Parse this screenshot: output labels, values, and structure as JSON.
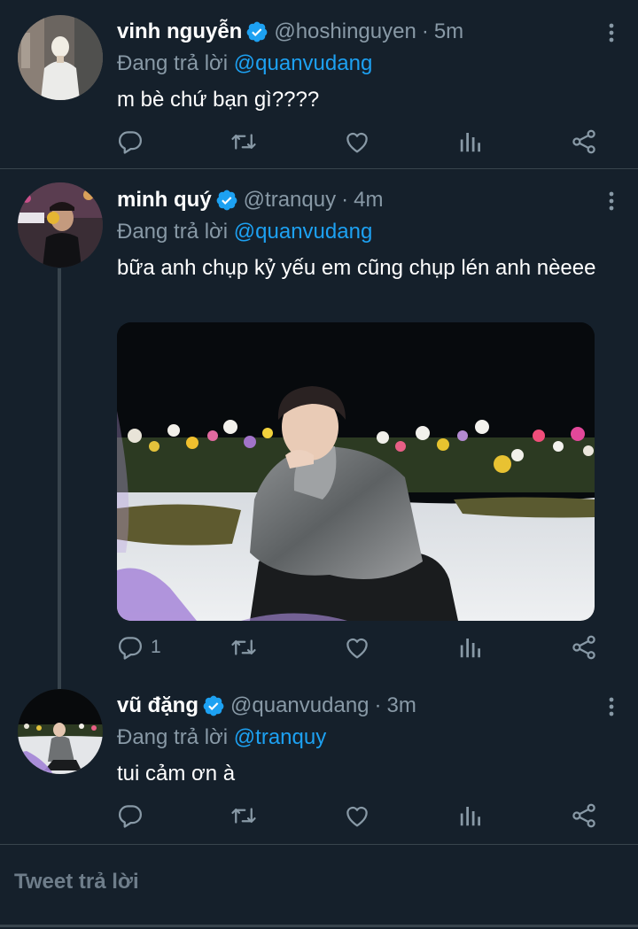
{
  "tweets": [
    {
      "name": "vinh nguyễn",
      "handle": "@hoshinguyen",
      "dot": "·",
      "time": "5m",
      "replying_label": "Đang trả lời",
      "replying_to": "@quanvudang",
      "text": "m bè chứ bạn gì????",
      "reply_count": ""
    },
    {
      "name": "minh quý",
      "handle": "@tranquy",
      "dot": "·",
      "time": "4m",
      "replying_label": "Đang trả lời",
      "replying_to": "@quanvudang",
      "text": "bữa anh chụp kỷ yếu em cũng chụp lén anh nèeee",
      "reply_count": "1"
    },
    {
      "name": "vũ đặng",
      "handle": "@quanvudang",
      "dot": "·",
      "time": "3m",
      "replying_label": "Đang trả lời",
      "replying_to": "@tranquy",
      "text": "tui cảm ơn à",
      "reply_count": ""
    }
  ],
  "reply_box": {
    "placeholder": "Tweet trả lời"
  },
  "icons": [
    "verified-badge-icon",
    "more-vertical-icon",
    "reply-icon",
    "retweet-icon",
    "like-icon",
    "analytics-icon",
    "share-icon"
  ],
  "colors": {
    "background": "#15202b",
    "accent": "#1da1f2",
    "muted": "#8899a6",
    "divider": "#38444d"
  }
}
